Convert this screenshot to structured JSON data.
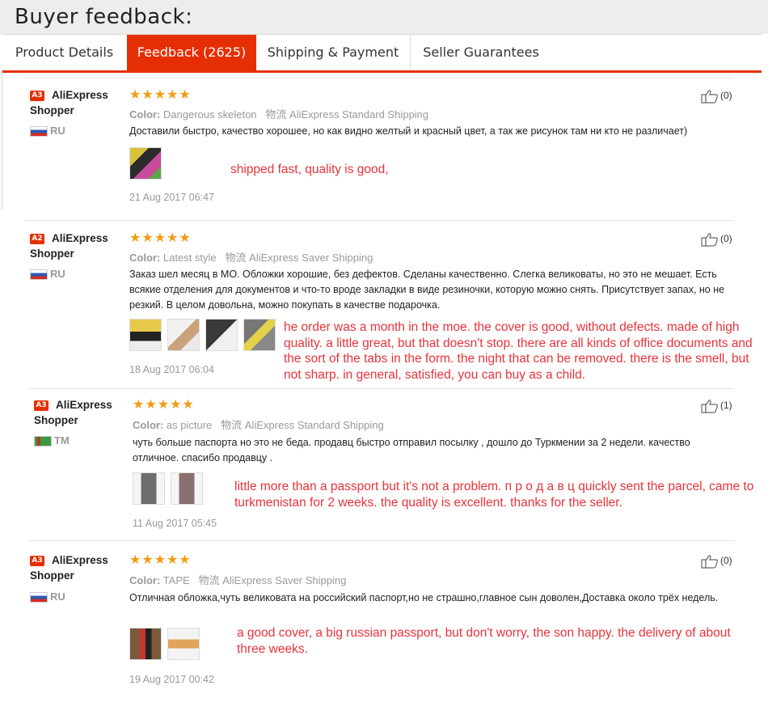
{
  "page_title": "Buyer feedback:",
  "tabs": [
    {
      "label": "Product Details",
      "active": false
    },
    {
      "label": "Feedback (2625)",
      "active": true
    },
    {
      "label": "Shipping & Payment",
      "active": false
    },
    {
      "label": "Seller Guarantees",
      "active": false
    }
  ],
  "colors": {
    "accent": "#e62e04",
    "star": "#f39c12",
    "translation": "#e8333a"
  },
  "reviews": [
    {
      "badge": "A3",
      "name_line1": "AliExpress",
      "name_line2": "Shopper",
      "country": "RU",
      "stars": "★★★★★",
      "color_label": "Color:",
      "color_value": "Dangerous skeleton",
      "logistics_label": "物流",
      "shipping": "AliExpress Standard Shipping",
      "text": "Доставили быстро, качество хорошее, но как видно желтый и красный цвет, а так же рисунок там ни кто не различает)",
      "translation": "shipped fast, quality is good,",
      "date": "21 Aug 2017 06:47",
      "likes": "(0)"
    },
    {
      "badge": "A2",
      "name_line1": "AliExpress",
      "name_line2": "Shopper",
      "country": "RU",
      "stars": "★★★★★",
      "color_label": "Color:",
      "color_value": "Latest style",
      "logistics_label": "物流",
      "shipping": "AliExpress Saver Shipping",
      "text": "Заказ шел месяц в МО. Обложки хорошие, без дефектов. Сделаны качественно. Слегка великоваты, но это не мешает. Есть всякие отделения для документов и что-то вроде закладки в виде резиночки, которую можно снять. Присутствует запах, но не резкий. В целом довольна, можно покупать в качестве подарочка.",
      "translation": "he order was a month in the moe. the cover is good, without defects. made of high quality. a little great, but that doesn't stop. there are all kinds of office documents and the sort of the tabs in the form. the night that can be removed. there is the smell, but not sharp. in general, satisfied, you can buy as a child.",
      "date": "18 Aug 2017 06:04",
      "likes": "(0)"
    },
    {
      "badge": "A3",
      "name_line1": "AliExpress",
      "name_line2": "Shopper",
      "country": "TM",
      "stars": "★★★★★",
      "color_label": "Color:",
      "color_value": "as picture",
      "logistics_label": "物流",
      "shipping": "AliExpress Standard Shipping",
      "text": "чуть больше паспорта но это не беда. продавц быстро отправил посылку , дошло до Туркмении за 2 недели. качество отличное. спасибо продавцу .",
      "translation": "little more than a passport but it's not a problem. п р о д а в ц quickly sent the parcel, came to turkmenistan for 2 weeks. the quality is excellent. thanks for the seller.",
      "date": "11 Aug 2017 05:45",
      "likes": "(1)"
    },
    {
      "badge": "A3",
      "name_line1": "AliExpress",
      "name_line2": "Shopper",
      "country": "RU",
      "stars": "★★★★★",
      "color_label": "Color:",
      "color_value": "TAPE",
      "logistics_label": "物流",
      "shipping": "AliExpress Saver Shipping",
      "text": "Отличная обложка,чуть великовата на российский паспорт,но не страшно,главное сын доволен,Доставка около трёх недель.",
      "translation": "a good cover, a big russian passport, but don't worry, the son happy. the delivery of about three weeks.",
      "date": "19 Aug 2017 00:42",
      "likes": "(0)"
    }
  ]
}
